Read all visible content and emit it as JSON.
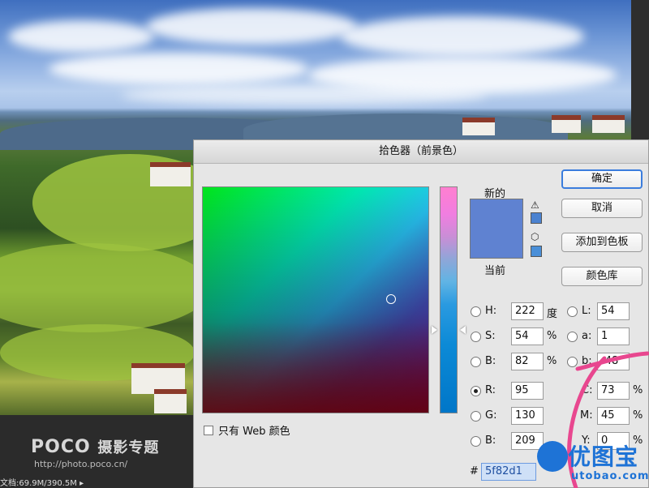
{
  "background": {
    "watermark_brand": "POCO",
    "watermark_brand_suffix": "摄影专题",
    "watermark_url": "http://photo.poco.cn/",
    "status_text": "文档:69.9M/390.5M"
  },
  "dialog": {
    "title": "拾色器（前景色）",
    "new_label": "新的",
    "current_label": "当前",
    "new_color": "#5f82d1",
    "buttons": {
      "ok": "确定",
      "cancel": "取消",
      "add_to_swatches": "添加到色板",
      "color_libraries": "颜色库"
    },
    "web_only_label": "只有 Web 颜色",
    "hsb": {
      "h_label": "H:",
      "h_value": "222",
      "h_unit": "度",
      "s_label": "S:",
      "s_value": "54",
      "s_unit": "%",
      "b_label": "B:",
      "b_value": "82",
      "b_unit": "%"
    },
    "rgb": {
      "r_label": "R:",
      "r_value": "95",
      "g_label": "G:",
      "g_value": "130",
      "b_label": "B:",
      "b_value": "209"
    },
    "lab": {
      "l_label": "L:",
      "l_value": "54",
      "a_label": "a:",
      "a_value": "1",
      "b_label": "b:",
      "b_value": "-48"
    },
    "cmyk": {
      "c_label": "C:",
      "c_value": "73",
      "c_unit": "%",
      "m_label": "M:",
      "m_value": "45",
      "m_unit": "%",
      "y_label": "Y:",
      "y_value": "0",
      "y_unit": "%"
    },
    "hex_label": "#",
    "hex_value": "5f82d1"
  },
  "logo": {
    "name_cn": "优图宝",
    "name_en": "utobao.com"
  }
}
